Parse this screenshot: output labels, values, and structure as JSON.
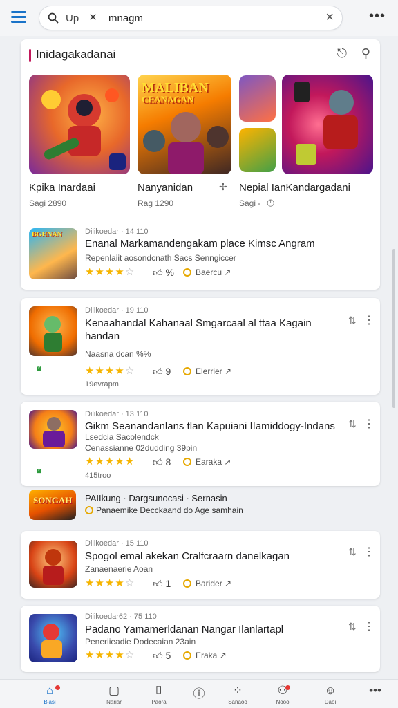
{
  "search": {
    "prefix": "Up",
    "value": "mnagm"
  },
  "featured": {
    "title": "Inidagakadanai",
    "items": [
      {
        "name": "Kpika Inardaai",
        "sub": "Sagi 2890"
      },
      {
        "name": "Nanyanidan",
        "sub": "Rag 1290"
      },
      {
        "name": "Nepial IanKandargadani",
        "sub": "Sagi -"
      }
    ],
    "art_title_1": "MALIBAN",
    "art_title_2": "CEANAGAN"
  },
  "list": [
    {
      "meta": "Dilikoedar · 14 110",
      "title": "Enanal Markamandengakam place Kimsc Angram",
      "sub": "Repenlaiit aosondcnath Sacs Senngiccer",
      "rating": 4,
      "thumbs": "%",
      "badge": "Baercu",
      "icon_title": "BGHNAN"
    },
    {
      "meta": "Dilikoedar · 19 110",
      "title": "Kenaahandal Kahanaal Smgarcaal al ttaa Kagain handan",
      "sub": "Naasna dcan %%",
      "rating": 4,
      "thumbs": "9",
      "badge": "Elerrier",
      "extra": "19evrapm"
    },
    {
      "meta": "Dilikoedar · 13 110",
      "title": "Gikm Seanandanlans tlan Kapuiani IIamiddogy-Indans",
      "title2": "Lsedcia Sacolendck",
      "sub": "Cenassianne 02dudding 39pin",
      "rating": 5,
      "thumbs": "8",
      "badge": "Earaka",
      "extra": "415troo"
    },
    {
      "title": "PAIIkung · Dargsunocasi · Sernasin",
      "sub": "Panaemike Decckaand do Age samhain",
      "icon_title": "SONGAH"
    },
    {
      "meta": "Dilikoedar · 15 110",
      "title": "Spogol emal akekan Cralfcraarn danelkagan",
      "sub": "Zanaenaerie Aoan",
      "rating": 4,
      "thumbs": "1",
      "badge": "Barider"
    },
    {
      "meta": "Dilikoedar62 · 75 110",
      "title": "Padano Yamamerldanan Nangar Ilanlartapl",
      "sub": "Peneriieadie Dodecaian 23ain",
      "rating": 4,
      "thumbs": "5",
      "badge": "Eraka"
    }
  ],
  "nav": [
    {
      "label": "Biasi",
      "icon": "home-icon"
    },
    {
      "label": "Nariar",
      "icon": "square-icon"
    },
    {
      "label": "Paora",
      "icon": "bag-icon"
    },
    {
      "label": "",
      "icon": "info-circle-icon"
    },
    {
      "label": "Sanaoo",
      "icon": "grid-icon"
    },
    {
      "label": "Nooo",
      "icon": "person-icon"
    },
    {
      "label": "Daoi",
      "icon": "face-icon"
    },
    {
      "label": "",
      "icon": "more-icon"
    }
  ],
  "colors": {
    "accent": "#1a73c8",
    "star": "#f5b400",
    "notification": "#e53935"
  }
}
